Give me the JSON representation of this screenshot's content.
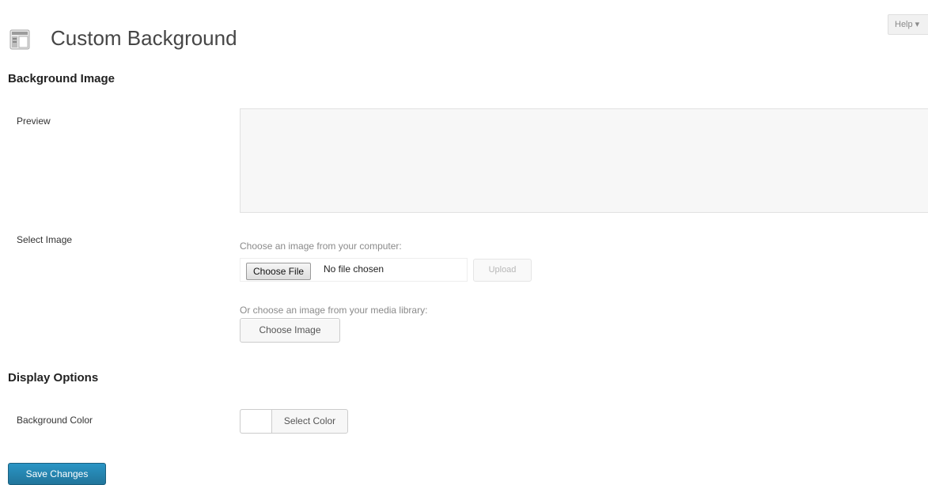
{
  "header": {
    "title": "Custom Background",
    "icon": "appearance-background-icon",
    "help_label": "Help ▾"
  },
  "background_image": {
    "heading": "Background Image",
    "preview_label": "Preview",
    "select_label": "Select Image",
    "computer_hint": "Choose an image from your computer:",
    "choose_file_label": "Choose File",
    "no_file_text": "No file chosen",
    "upload_label": "Upload",
    "library_hint": "Or choose an image from your media library:",
    "choose_image_label": "Choose Image"
  },
  "display_options": {
    "heading": "Display Options",
    "bg_color_label": "Background Color",
    "select_color_label": "Select Color",
    "swatch_color": "#ffffff"
  },
  "footer": {
    "save_label": "Save Changes"
  },
  "colors": {
    "primary_button": "#21759b",
    "preview_bg": "#f7f7f7"
  }
}
